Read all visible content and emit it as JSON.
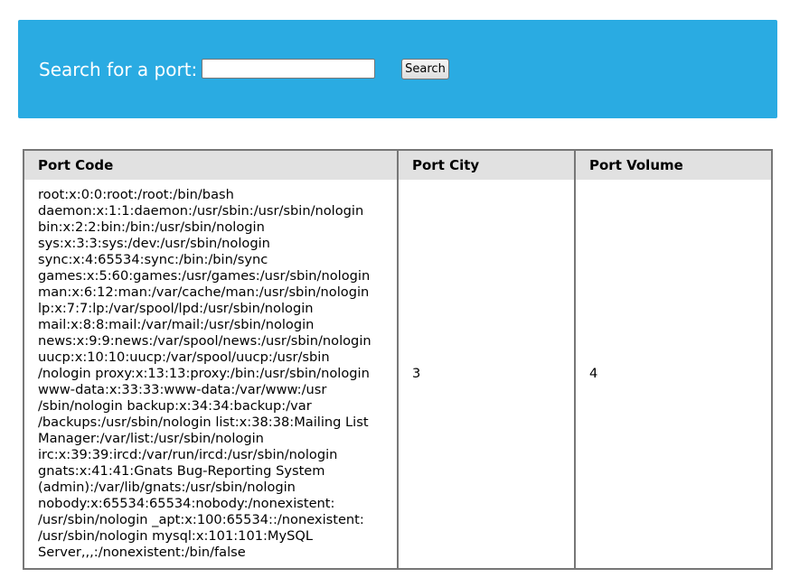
{
  "header": {
    "search_label": "Search for a port:",
    "search_value": "",
    "search_placeholder": "",
    "search_button_label": "Search",
    "background_color": "#2aabe2"
  },
  "table": {
    "columns": [
      "Port Code",
      "Port City",
      "Port Volume"
    ],
    "rows": [
      {
        "code": "root:x:0:0:root:/root:/bin/bash\ndaemon:x:1:1:daemon:/usr/sbin:/usr/sbin/nologin\nbin:x:2:2:bin:/bin:/usr/sbin/nologin\nsys:x:3:3:sys:/dev:/usr/sbin/nologin\nsync:x:4:65534:sync:/bin:/bin/sync\ngames:x:5:60:games:/usr/games:/usr/sbin/nologin\nman:x:6:12:man:/var/cache/man:/usr/sbin/nologin\nlp:x:7:7:lp:/var/spool/lpd:/usr/sbin/nologin\nmail:x:8:8:mail:/var/mail:/usr/sbin/nologin\nnews:x:9:9:news:/var/spool/news:/usr/sbin/nologin\nuucp:x:10:10:uucp:/var/spool/uucp:/usr/sbin\n/nologin proxy:x:13:13:proxy:/bin:/usr/sbin/nologin\nwww-data:x:33:33:www-data:/var/www:/usr\n/sbin/nologin backup:x:34:34:backup:/var\n/backups:/usr/sbin/nologin list:x:38:38:Mailing List\nManager:/var/list:/usr/sbin/nologin\nirc:x:39:39:ircd:/var/run/ircd:/usr/sbin/nologin\ngnats:x:41:41:Gnats Bug-Reporting System\n(admin):/var/lib/gnats:/usr/sbin/nologin\nnobody:x:65534:65534:nobody:/nonexistent:\n/usr/sbin/nologin _apt:x:100:65534::/nonexistent:\n/usr/sbin/nologin mysql:x:101:101:MySQL\nServer,,,:/nonexistent:/bin/false",
        "city": "3",
        "volume": "4"
      }
    ]
  }
}
